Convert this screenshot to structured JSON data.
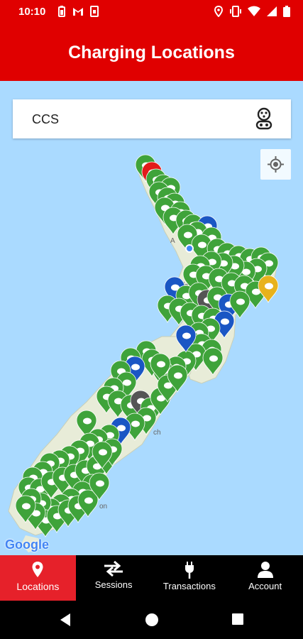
{
  "status_bar": {
    "time": "10:10",
    "left_icons": [
      "battery-saver-icon",
      "gmail-icon",
      "sim-icon"
    ],
    "right_icons": [
      "location-icon",
      "vibrate-icon",
      "wifi-icon",
      "signal-icon",
      "battery-icon"
    ]
  },
  "header": {
    "title": "Charging Locations"
  },
  "search": {
    "value": "CCS",
    "connector_icon": "ccs-connector-icon"
  },
  "map": {
    "attribution": "Google",
    "colors": {
      "water": "#aadaff",
      "land": "#e8ecd8",
      "marker_green": "#3fa33a",
      "marker_blue": "#1a56c4",
      "marker_red": "#e31b1b",
      "marker_gray": "#555555",
      "marker_yellow": "#e8b21c"
    },
    "locate_icon": "my-location-icon"
  },
  "bottom_nav": {
    "items": [
      {
        "label": "Locations",
        "icon": "map-pin-icon",
        "active": true
      },
      {
        "label": "Sessions",
        "icon": "swap-arrows-icon",
        "active": false
      },
      {
        "label": "Transactions",
        "icon": "plug-icon",
        "active": false
      },
      {
        "label": "Account",
        "icon": "person-icon",
        "active": false
      }
    ],
    "active_color": "#e6212a"
  },
  "system_nav": [
    "back-icon",
    "home-icon",
    "recents-icon"
  ]
}
